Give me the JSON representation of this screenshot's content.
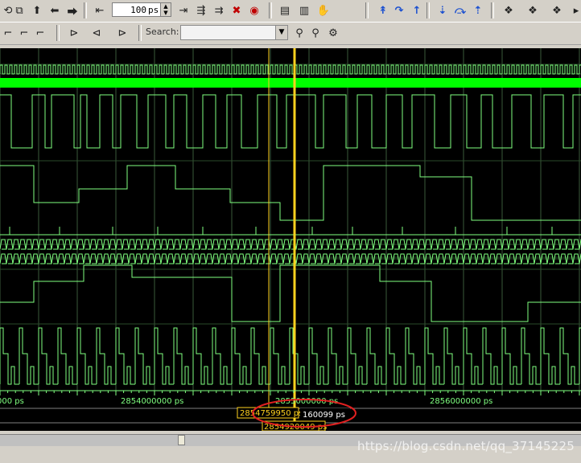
{
  "toolbar": {
    "zoom_value": "100",
    "zoom_unit": "ps",
    "search_label": "Search:",
    "search_placeholder": ""
  },
  "waveform": {
    "background": "#000000",
    "signal_color": "#7fff7f",
    "bus_color": "#00ff00",
    "cursor_color": "#ffd21e",
    "time_axis": {
      "labels": [
        "000 ps",
        "2854000000 ps",
        "2855000000 ps",
        "2856000000 ps"
      ]
    },
    "cursors": {
      "cursor1_time": "2854759950 ps",
      "cursor2_time": "2854920049 ps",
      "delta": "160099 ps"
    }
  },
  "watermark": "https://blog.csdn.net/qq_37145225"
}
